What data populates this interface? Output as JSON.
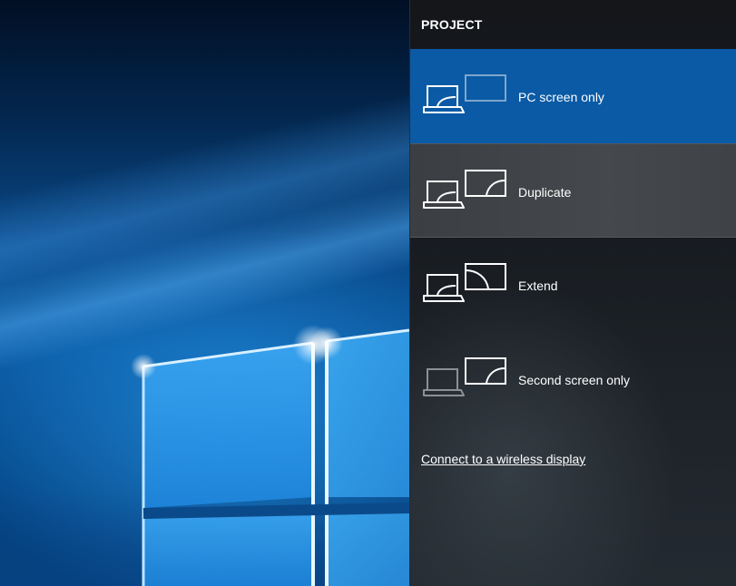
{
  "panel": {
    "title": "PROJECT",
    "options": [
      {
        "label": "PC screen only",
        "icon": "pc-screen-only-icon",
        "state": "selected"
      },
      {
        "label": "Duplicate",
        "icon": "duplicate-icon",
        "state": "hover"
      },
      {
        "label": "Extend",
        "icon": "extend-icon",
        "state": "normal"
      },
      {
        "label": "Second screen only",
        "icon": "second-screen-only-icon",
        "state": "normal"
      }
    ],
    "wireless_link": "Connect to a wireless display"
  },
  "colors": {
    "selected": "#0a5aa5",
    "hover": "#424549",
    "panel_bg": "#181c21",
    "text": "#ffffff"
  }
}
